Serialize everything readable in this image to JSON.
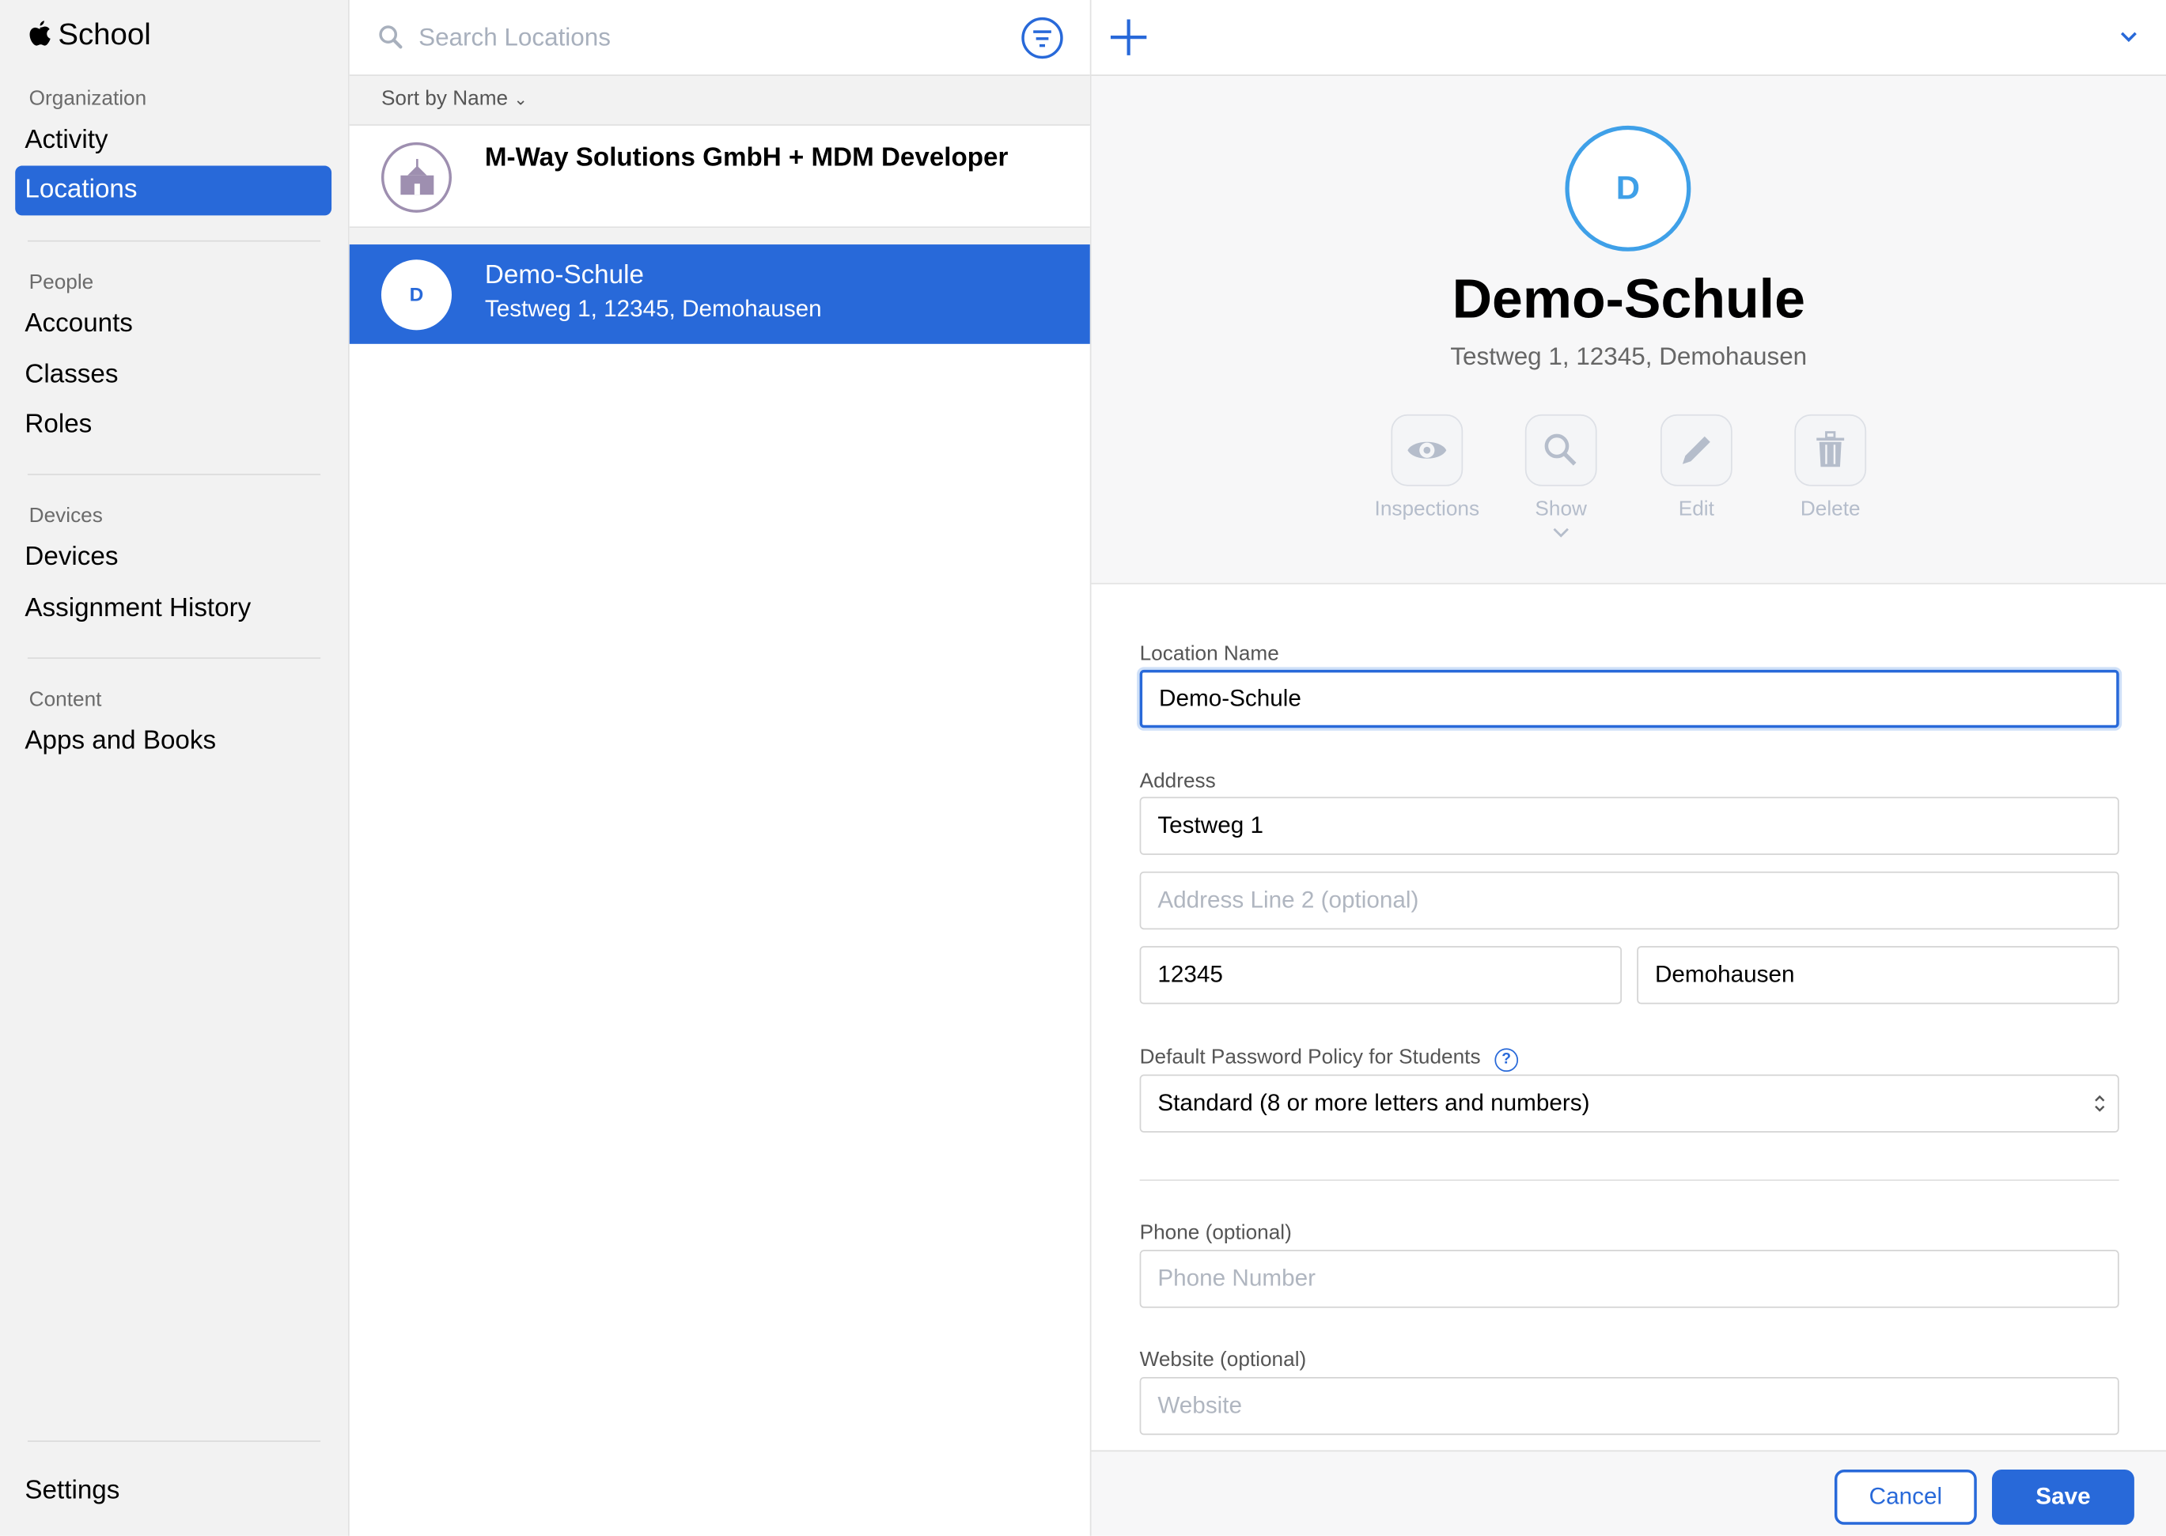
{
  "app": {
    "title": "School"
  },
  "sidebar": {
    "sections": [
      {
        "label": "Organization",
        "items": [
          {
            "label": "Activity"
          },
          {
            "label": "Locations",
            "selected": true
          }
        ]
      },
      {
        "label": "People",
        "items": [
          {
            "label": "Accounts"
          },
          {
            "label": "Classes"
          },
          {
            "label": "Roles"
          }
        ]
      },
      {
        "label": "Devices",
        "items": [
          {
            "label": "Devices"
          },
          {
            "label": "Assignment History"
          }
        ]
      },
      {
        "label": "Content",
        "items": [
          {
            "label": "Apps and Books"
          }
        ]
      }
    ],
    "settings": "Settings"
  },
  "list": {
    "search_placeholder": "Search Locations",
    "sort_label": "Sort by Name",
    "rows": [
      {
        "title": "M-Way Solutions GmbH + MDM Developer",
        "icon": "school-building-icon"
      },
      {
        "title": "Demo-Schule",
        "subtitle": "Testweg 1, 12345, Demohausen",
        "initial": "D",
        "selected": true
      }
    ]
  },
  "detail": {
    "initial": "D",
    "name": "Demo-Schule",
    "address": "Testweg 1, 12345, Demohausen",
    "actions": [
      {
        "label": "Inspections",
        "icon": "eye-icon"
      },
      {
        "label": "Show",
        "icon": "magnifier-icon"
      },
      {
        "label": "Edit",
        "icon": "pencil-icon"
      },
      {
        "label": "Delete",
        "icon": "trash-icon"
      }
    ],
    "form": {
      "location_name_label": "Location Name",
      "location_name": "Demo-Schule",
      "address_label": "Address",
      "address1": "Testweg 1",
      "address2_placeholder": "Address Line 2 (optional)",
      "zip": "12345",
      "city": "Demohausen",
      "policy_label": "Default Password Policy for Students",
      "policy_value": "Standard (8 or more letters and numbers)",
      "phone_label": "Phone (optional)",
      "phone_placeholder": "Phone Number",
      "website_label": "Website (optional)",
      "website_placeholder": "Website"
    },
    "cancel": "Cancel",
    "save": "Save"
  },
  "colors": {
    "accent": "#2869d9",
    "avatar_ring": "#3fa0e8",
    "school_icon": "#9e8fb0"
  }
}
